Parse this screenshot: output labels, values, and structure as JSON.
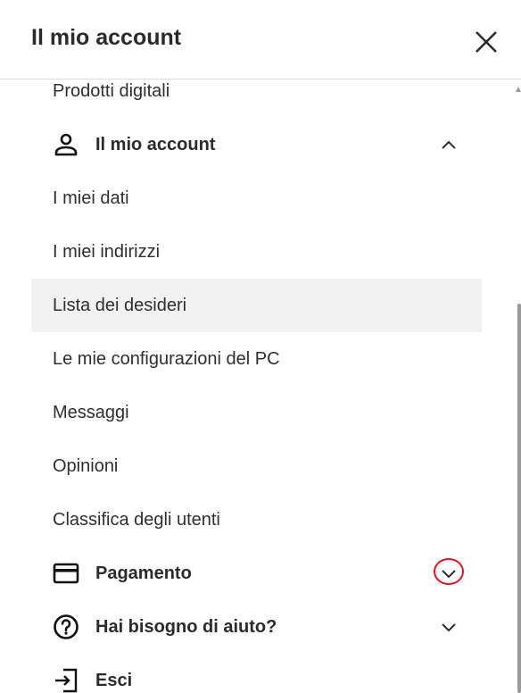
{
  "header": {
    "title": "Il mio account"
  },
  "menu": {
    "top_item": "Prodotti digitali",
    "account_section": {
      "label": "Il mio account",
      "icon": "person-icon",
      "expanded": true
    },
    "account_items": [
      {
        "label": "I miei dati"
      },
      {
        "label": "I miei indirizzi"
      },
      {
        "label": "Lista dei desideri",
        "highlighted": true
      },
      {
        "label": "Le mie configurazioni del PC"
      },
      {
        "label": "Messaggi"
      },
      {
        "label": "Opinioni"
      },
      {
        "label": "Classifica degli utenti"
      }
    ],
    "payment_section": {
      "label": "Pagamento",
      "icon": "credit-card-icon",
      "expanded": false
    },
    "help_section": {
      "label": "Hai bisogno di aiuto?",
      "icon": "help-circle-icon",
      "expanded": false
    },
    "logout": {
      "label": "Esci",
      "icon": "logout-icon"
    }
  },
  "colors": {
    "highlight_bg": "#f2f2f2",
    "annotation_red": "#e0141e",
    "text": "#2f2f2f"
  }
}
